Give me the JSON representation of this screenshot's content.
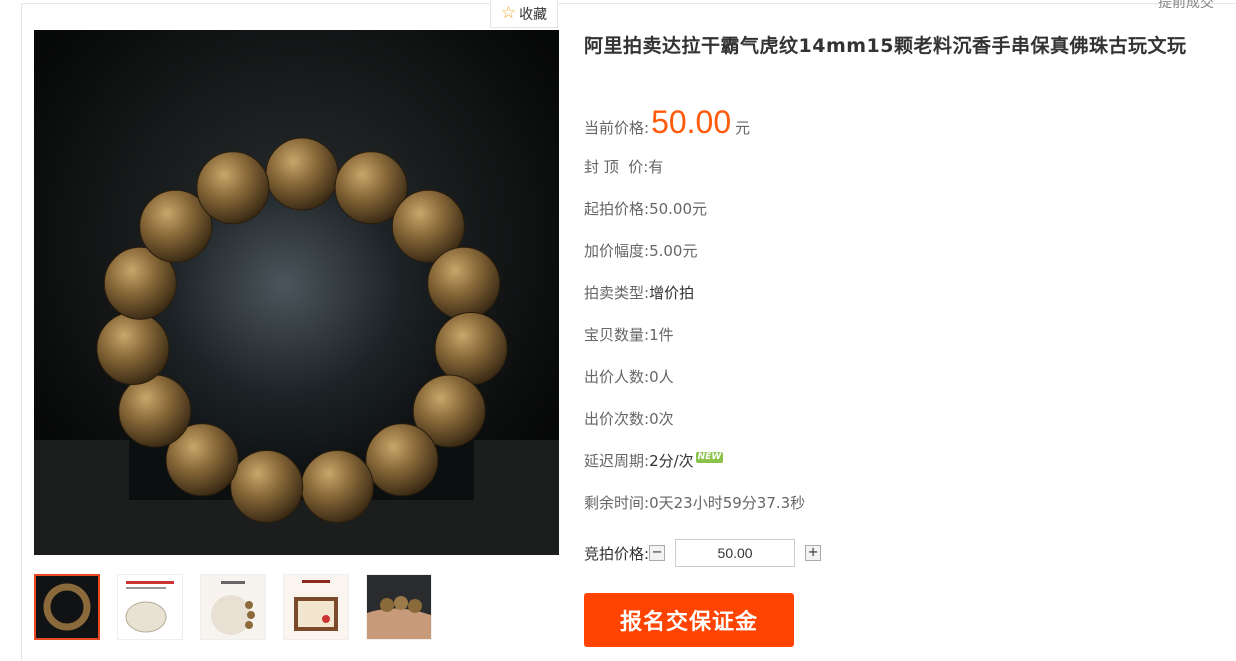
{
  "header": {
    "early_deal": "提前成交",
    "favorite_label": "收藏",
    "favorite_icon": "star-icon"
  },
  "gallery": {
    "main_image": "agarwood-bracelet-photo",
    "thumbnails": [
      "bracelet-thumb",
      "wood-sample-thumb",
      "beads-thumb",
      "certificate-thumb",
      "wrist-thumb"
    ],
    "active_index": 0
  },
  "product": {
    "title": "阿里拍卖达拉干霸气虎纹14mm15颗老料沉香手串保真佛珠古玩文玩",
    "current_price_label": "当前价格:",
    "current_price": "50.00",
    "current_price_unit": "元",
    "cap_label": "封 顶  价:",
    "cap_value": "有",
    "start_label": "起拍价格:",
    "start_value": "50.00元",
    "increment_label": "加价幅度:",
    "increment_value": "5.00元",
    "type_label": "拍卖类型:",
    "type_value": "增价拍",
    "qty_label": "宝贝数量:",
    "qty_value": "1件",
    "bidders_label": "出价人数:",
    "bidders_value": "0人",
    "bids_label": "出价次数:",
    "bids_value": "0次",
    "delay_label": "延迟周期:",
    "delay_value": "2分/次",
    "new_badge": "NEW",
    "remaining_label": "剩余时间:",
    "remaining_value": "0天23小时59分37.3秒"
  },
  "bid": {
    "label": "竞拍价格:",
    "minus": "−",
    "plus": "+",
    "value": "50.00"
  },
  "deposit_button": "报名交保证金",
  "colors": {
    "price": "#ff5b0a",
    "button": "#ff4300",
    "active_thumb": "#e94a1f"
  }
}
